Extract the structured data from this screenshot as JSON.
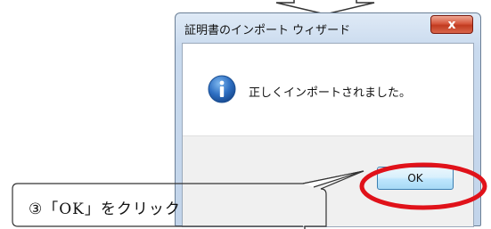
{
  "dialog": {
    "title": "証明書のインポート ウィザード",
    "close_label": "x",
    "message": "正しくインポートされました。",
    "ok_label": "OK",
    "icon": "info-icon"
  },
  "annotation": {
    "callout_text": "③「OK」をクリック",
    "highlight_color": "#e0121a"
  }
}
